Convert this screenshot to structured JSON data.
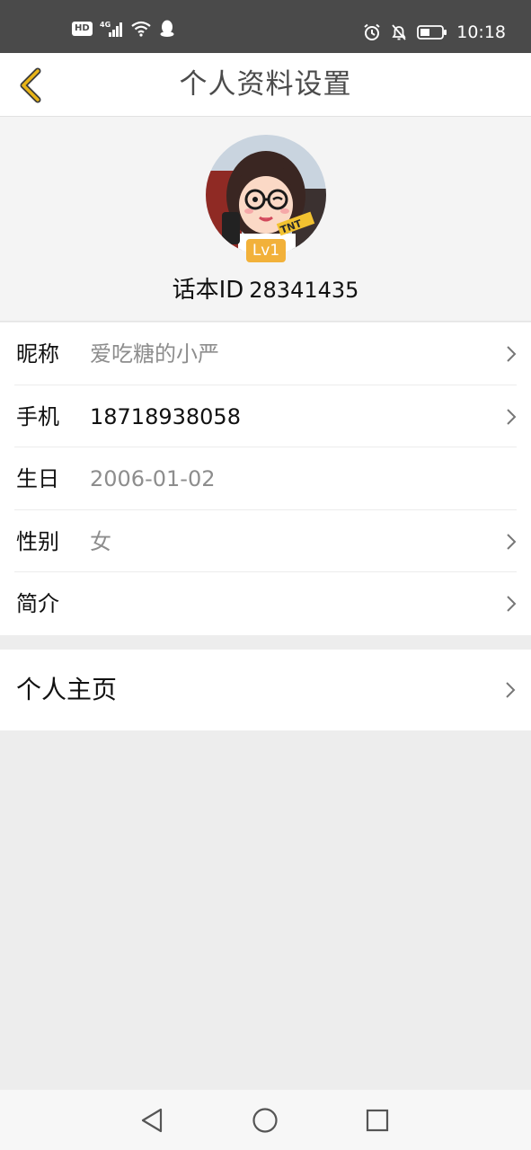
{
  "status_bar": {
    "hd_label": "HD",
    "network": "4G",
    "time": "10:18",
    "icons": [
      "hd-icon",
      "signal-4g-icon",
      "wifi-icon",
      "qq-icon",
      "alarm-icon",
      "mute-bell-icon",
      "battery-icon"
    ]
  },
  "header": {
    "title": "个人资料设置",
    "back_icon": "chevron-left-icon",
    "accent_color": "#e8b417"
  },
  "profile": {
    "level_badge": "Lv1",
    "id_label": "话本ID",
    "id_value": "28341435"
  },
  "fields": [
    {
      "label": "昵称",
      "value": "爱吃糖的小严",
      "has_arrow": true
    },
    {
      "label": "手机",
      "value": "18718938058",
      "has_arrow": true
    },
    {
      "label": "生日",
      "value": "2006-01-02",
      "has_arrow": false
    },
    {
      "label": "性别",
      "value": "女",
      "has_arrow": true
    },
    {
      "label": "简介",
      "value": "",
      "has_arrow": true
    }
  ],
  "homepage": {
    "label": "个人主页"
  },
  "nav": {
    "icons": [
      "back-triangle-icon",
      "home-circle-icon",
      "recents-square-icon"
    ]
  }
}
